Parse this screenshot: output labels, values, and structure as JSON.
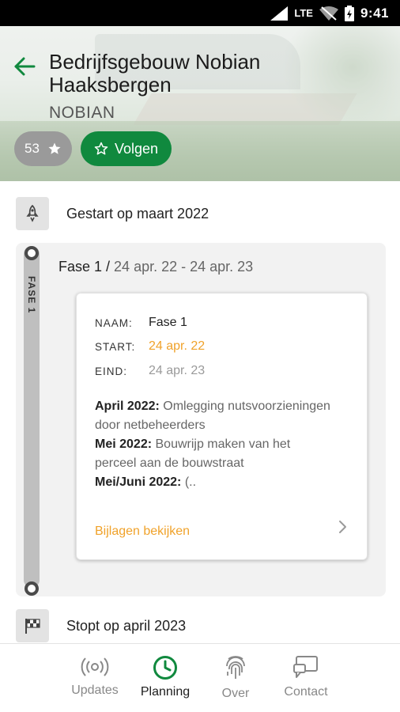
{
  "status_bar": {
    "network": "LTE",
    "time": "9:41"
  },
  "header": {
    "title": "Bedrijfsgebouw Nobian Haaksbergen",
    "company": "NOBIAN",
    "rating": "53",
    "follow_label": "Volgen",
    "accent_color": "#10893e"
  },
  "timeline": {
    "start_text": "Gestart op maart 2022",
    "end_text": "Stopt op april 2023",
    "phase": {
      "vertical_label": "FASE 1",
      "title": "Fase 1 /",
      "range": "24 apr. 22 - 24 apr. 23",
      "card": {
        "name_key": "NAAM:",
        "name_value": "Fase 1",
        "start_key": "START:",
        "start_value": "24 apr. 22",
        "end_key": "EIND:",
        "end_value": "24 apr. 23",
        "start_color": "#f0a22a",
        "end_color": "#9a9a9a",
        "desc": [
          {
            "bold": "April 2022:",
            "text": " Omlegging nutsvoorzieningen door netbeheerders"
          },
          {
            "bold": "Mei 2022:",
            "text": " Bouwrijp maken van het perceel aan de bouwstraat"
          },
          {
            "bold": "Mei/Juni 2022:",
            "text": " (.."
          }
        ],
        "attachments_label": "Bijlagen bekijken"
      }
    }
  },
  "bottom_nav": [
    {
      "label": "Updates",
      "icon": "broadcast-icon",
      "active": false
    },
    {
      "label": "Planning",
      "icon": "clock-icon",
      "active": true
    },
    {
      "label": "Over",
      "icon": "fingerprint-icon",
      "active": false
    },
    {
      "label": "Contact",
      "icon": "chat-screen-icon",
      "active": false
    }
  ]
}
